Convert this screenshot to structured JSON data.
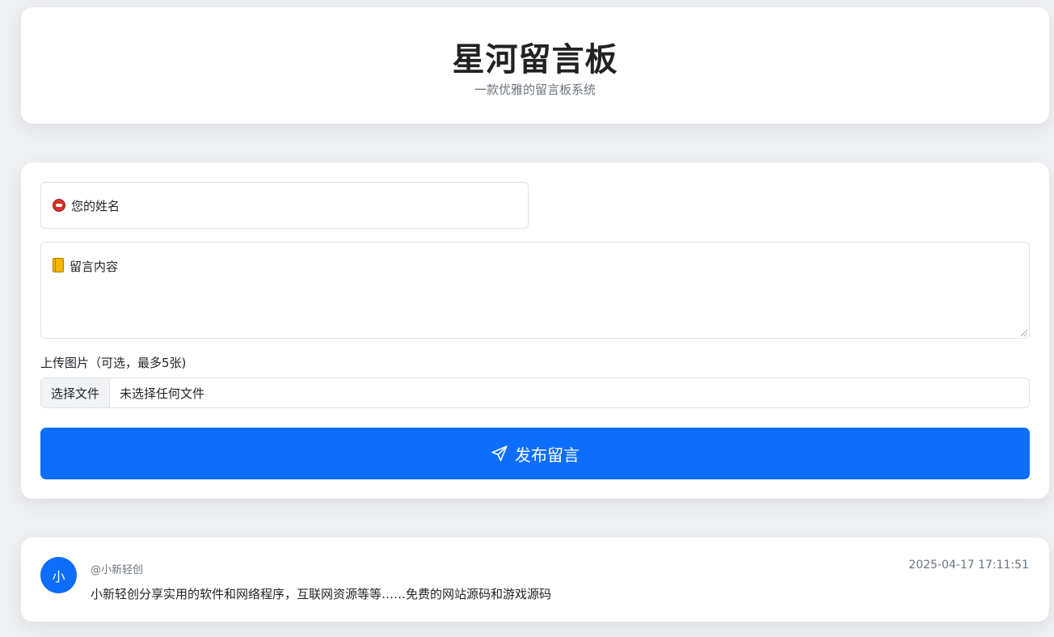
{
  "header": {
    "title": "星河留言板",
    "subtitle": "一款优雅的留言板系统"
  },
  "form": {
    "name_placeholder": "您的姓名",
    "name_icon": "mouth-emoji-icon",
    "message_placeholder": "留言内容",
    "message_icon": "notebook-emoji-icon",
    "upload_label": "上传图片（可选，最多5张)",
    "file_button": "选择文件",
    "file_status": "未选择任何文件",
    "submit_label": "发布留言",
    "submit_icon": "send-icon",
    "accent_color": "#0d6efd"
  },
  "messages": [
    {
      "avatar": "小",
      "author": "@小新轻创",
      "time": "2025-04-17 17:11:51",
      "content": "小新轻创分享实用的软件和网络程序，互联网资源等等……免费的网站源码和游戏源码"
    }
  ]
}
